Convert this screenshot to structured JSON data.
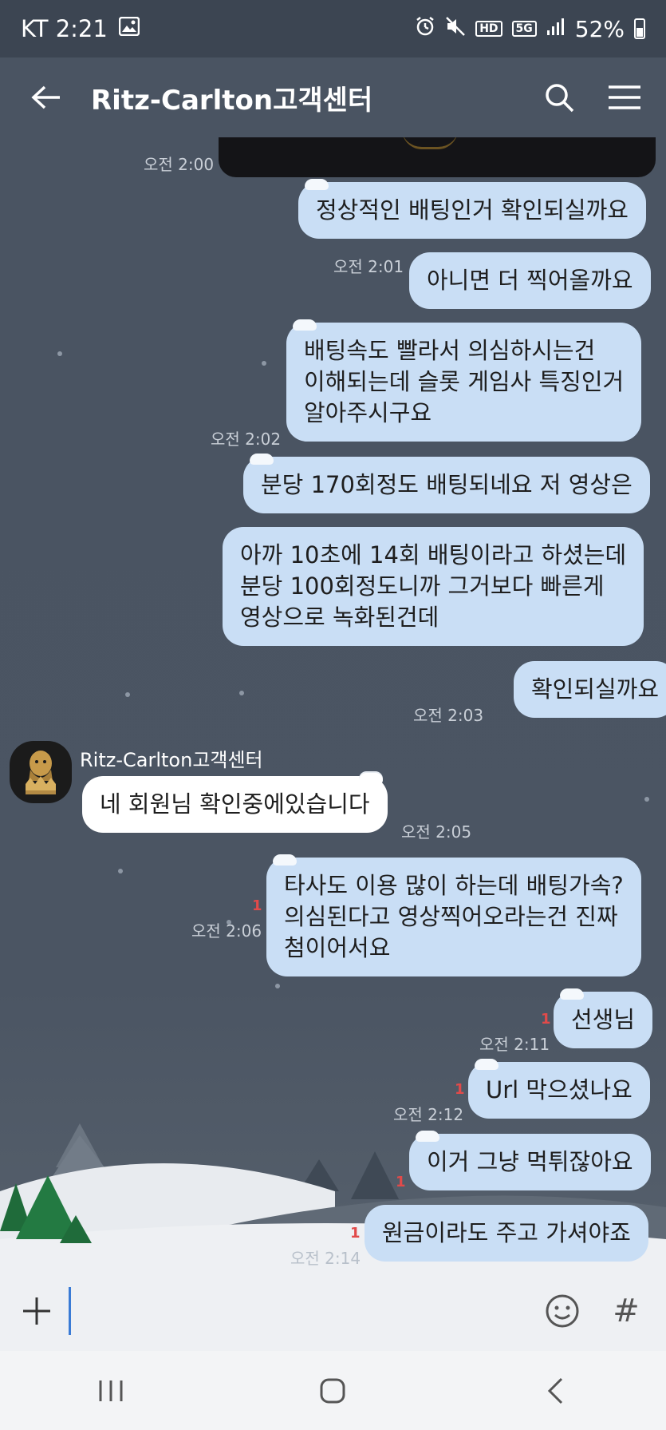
{
  "status_bar": {
    "carrier_time": "KT 2:21",
    "network_hd": "HD",
    "network_5g": "5G",
    "battery": "52%"
  },
  "header": {
    "title": "Ritz-Carlton고객센터"
  },
  "chat": {
    "sender_name": "Ritz-Carlton고객센터",
    "messages": [
      {
        "text": "정상적인 배팅인거 확인되실까요",
        "time": "오전 2:00"
      },
      {
        "text": "아니면 더 찍어올까요",
        "time": "오전 2:01"
      },
      {
        "lines": [
          "배팅속도 빨라서 의심하시는건",
          "이해되는데 슬롯 게임사 특징인거",
          "알아주시구요"
        ],
        "time": "오전 2:02"
      },
      {
        "text": "분당 170회정도 배팅되네요 저 영상은"
      },
      {
        "lines": [
          "아까 10초에 14회 배팅이라고 하셨는데",
          "분당 100회정도니까 그거보다 빠른게",
          "영상으로 녹화된건데"
        ]
      },
      {
        "text": "확인되실까요",
        "time": "오전 2:03"
      },
      {
        "text": "네 회원님 확인중에있습니다",
        "time": "오전 2:05",
        "incoming": true
      },
      {
        "lines": [
          "타사도 이용 많이 하는데 배팅가속?",
          "의심된다고 영상찍어오라는건 진짜",
          "첨이어서요"
        ],
        "time": "오전 2:06",
        "unread": "1"
      },
      {
        "text": "선생님",
        "time": "오전 2:11",
        "unread": "1"
      },
      {
        "text": "Url 막으셨나요",
        "time": "오전 2:12",
        "unread": "1"
      },
      {
        "text": "이거 그냥 먹튀잖아요",
        "unread": "1"
      },
      {
        "text": "원금이라도 주고 가셔야죠",
        "time": "오전 2:14",
        "unread": "1"
      }
    ]
  },
  "input": {
    "placeholder": "",
    "hash": "#"
  },
  "icons": [
    "back-arrow-icon",
    "search-icon",
    "menu-icon",
    "plus-icon",
    "emoji-icon",
    "hash-icon",
    "recent-apps-icon",
    "home-icon",
    "nav-back-icon"
  ]
}
